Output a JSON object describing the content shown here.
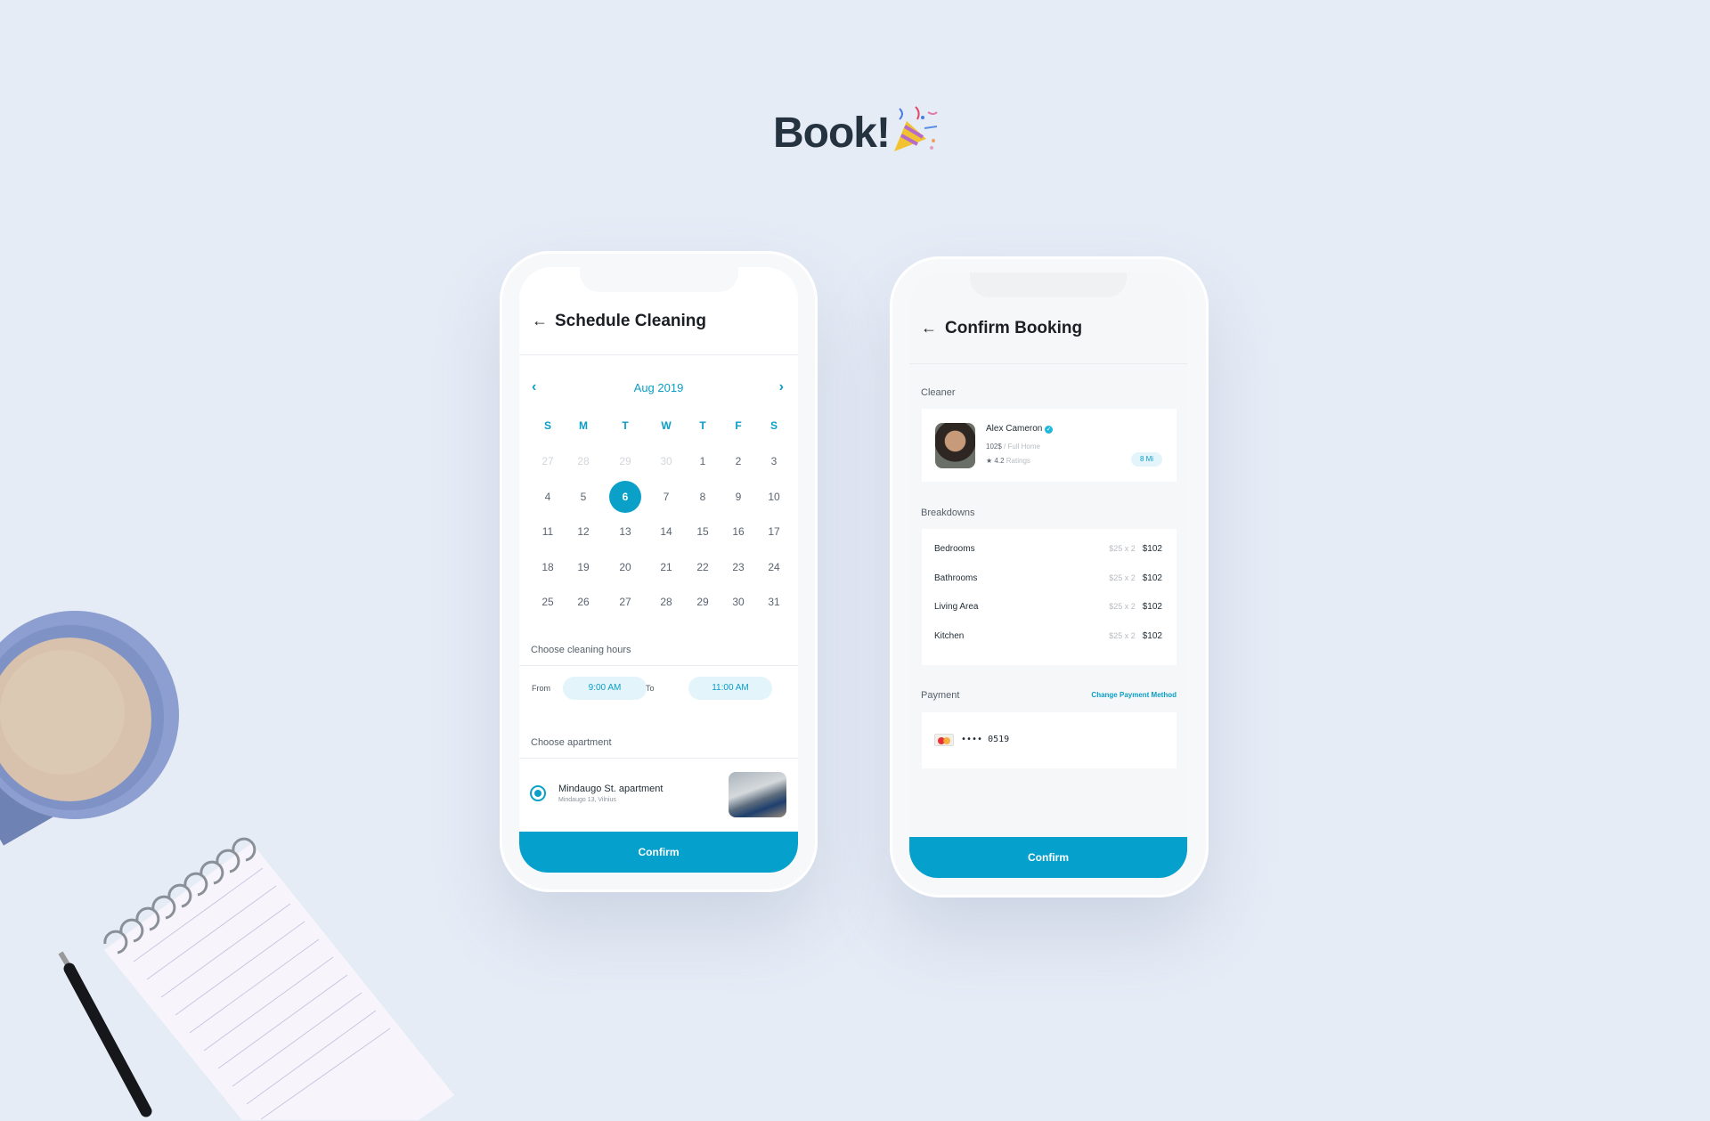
{
  "title": "Book!",
  "icons": {
    "celebration": "party-popper-icon"
  },
  "colors": {
    "accent": "#0aa0c8",
    "background": "#e6ecf6"
  },
  "schedule": {
    "title": "Schedule Cleaning",
    "month": "Aug 2019",
    "weekdays": [
      "S",
      "M",
      "T",
      "W",
      "T",
      "F",
      "S"
    ],
    "weeks": [
      [
        "27",
        "28",
        "29",
        "30",
        "1",
        "2",
        "3"
      ],
      [
        "4",
        "5",
        "6",
        "7",
        "8",
        "9",
        "10"
      ],
      [
        "11",
        "12",
        "13",
        "14",
        "15",
        "16",
        "17"
      ],
      [
        "18",
        "19",
        "20",
        "21",
        "22",
        "23",
        "24"
      ],
      [
        "25",
        "26",
        "27",
        "28",
        "29",
        "30",
        "31"
      ]
    ],
    "selected_day": "6",
    "hours_label": "Choose cleaning hours",
    "from_label": "From",
    "from_value": "9:00 AM",
    "to_label": "To",
    "to_value": "11:00 AM",
    "apartment_label": "Choose apartment",
    "apartment": {
      "name": "Mindaugo St. apartment",
      "address": "Mindaugo 13, Vilnius",
      "selected": true
    },
    "confirm": "Confirm"
  },
  "booking": {
    "title": "Confirm Booking",
    "cleaner_label": "Cleaner",
    "cleaner": {
      "name": "Alex Cameron",
      "price": "102$",
      "price_unit": "/ Full Home",
      "rating": "4.2",
      "rating_label": "Ratings",
      "distance": "8 Mi"
    },
    "breakdowns_label": "Breakdowns",
    "breakdowns": [
      {
        "name": "Bedrooms",
        "unit": "$25 x 2",
        "total": "$102"
      },
      {
        "name": "Bathrooms",
        "unit": "$25 x 2",
        "total": "$102"
      },
      {
        "name": "Living Area",
        "unit": "$25 x 2",
        "total": "$102"
      },
      {
        "name": "Kitchen",
        "unit": "$25 x 2",
        "total": "$102"
      }
    ],
    "payment_label": "Payment",
    "change_payment": "Change Payment Method",
    "card_masked": "•••• 0519",
    "confirm": "Confirm"
  }
}
